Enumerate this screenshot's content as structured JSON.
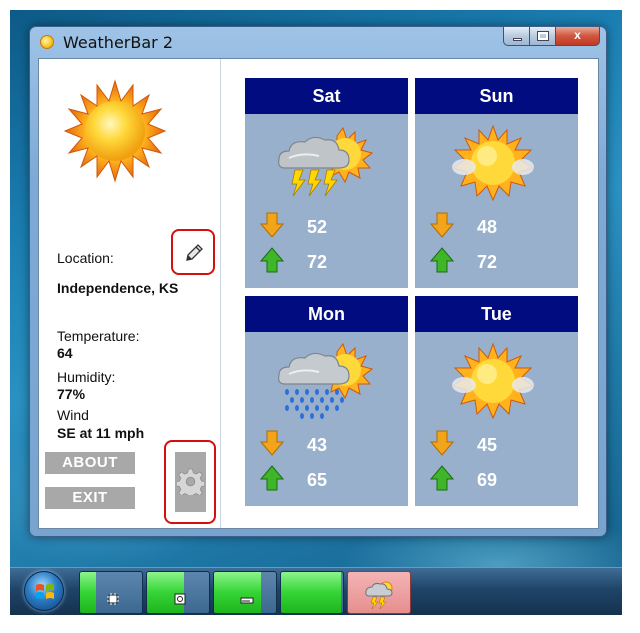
{
  "window": {
    "title": "WeatherBar 2",
    "controls": {
      "minimize": "minimize",
      "maximize": "maximize",
      "close": "x"
    }
  },
  "current": {
    "icon": "sun-icon",
    "location_label": "Location:",
    "location_value": "Independence, KS",
    "temperature_label": "Temperature:",
    "temperature_value": "64",
    "humidity_label": "Humidity:",
    "humidity_value": "77%",
    "wind_label": "Wind",
    "wind_value": "SE at 11 mph"
  },
  "buttons": {
    "about": "ABOUT",
    "exit": "EXIT",
    "edit_icon": "pencil-icon",
    "settings_icon": "gear-icon"
  },
  "forecast": [
    {
      "day": "Sat",
      "condition_icon": "thunderstorm-icon",
      "low": "52",
      "high": "72"
    },
    {
      "day": "Sun",
      "condition_icon": "hazy-sun-icon",
      "low": "48",
      "high": "72"
    },
    {
      "day": "Mon",
      "condition_icon": "rain-icon",
      "low": "43",
      "high": "65"
    },
    {
      "day": "Tue",
      "condition_icon": "hazy-sun-icon",
      "low": "45",
      "high": "69"
    }
  ],
  "taskbar": {
    "start_icon": "windows-logo-icon",
    "items": [
      {
        "icon": "cpu-icon",
        "meter": 0.25
      },
      {
        "icon": "memory-icon",
        "meter": 0.6
      },
      {
        "icon": "disk-icon",
        "meter": 0.75
      },
      {
        "icon": "network-icon",
        "meter": 0.97
      },
      {
        "icon": "weather-storm-icon",
        "meter": 0
      }
    ]
  },
  "colors": {
    "day_header": "#000c80",
    "day_body": "#98b0cb",
    "low_arrow": "#f2a41a",
    "high_arrow": "#3fb52a",
    "button_gray": "#a8a8a8",
    "highlight_red": "#d40f0f"
  }
}
